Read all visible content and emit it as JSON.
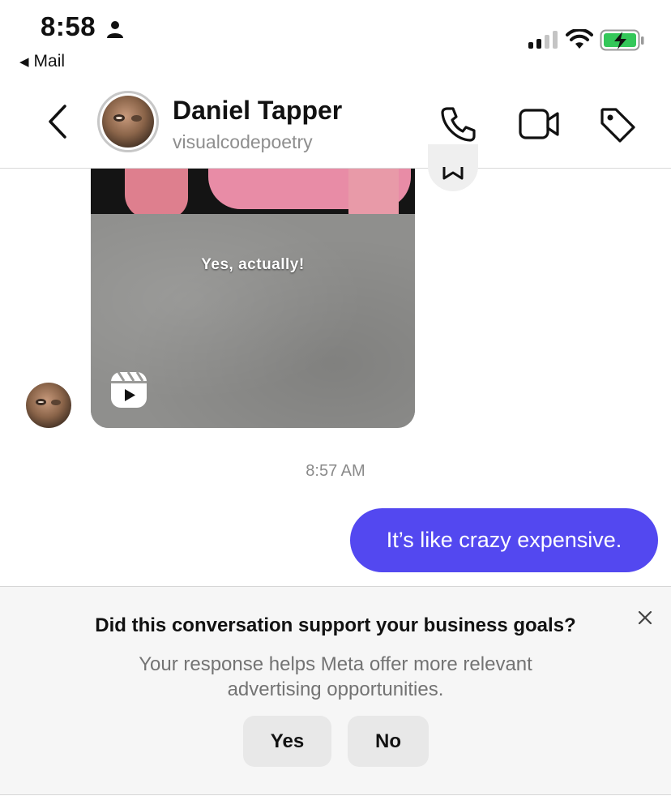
{
  "status_bar": {
    "time": "8:58",
    "back_app_label": "Mail"
  },
  "header": {
    "contact_name": "Daniel Tapper",
    "contact_handle": "visualcodepoetry",
    "icons": [
      "chevron-left-icon",
      "phone-icon",
      "video-camera-icon",
      "tag-icon"
    ]
  },
  "thread": {
    "reel_caption": "Yes, actually!",
    "timestamp": "8:57 AM",
    "sent_message": "It’s like crazy expensive."
  },
  "survey": {
    "question": "Did this conversation support your business goals?",
    "description": "Your response helps Meta offer more relevant advertising opportunities.",
    "yes_label": "Yes",
    "no_label": "No"
  },
  "colors": {
    "sent_bubble": "#5348f0",
    "battery_fill": "#34c759",
    "survey_background": "#f6f6f6"
  }
}
